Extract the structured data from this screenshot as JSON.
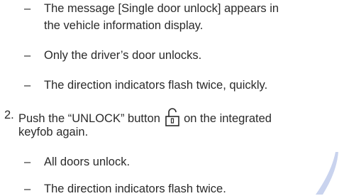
{
  "bullets_top": [
    {
      "dash": "–",
      "lines": [
        "The message [Single door unlock] appears in",
        "the vehicle information display."
      ]
    },
    {
      "dash": "–",
      "lines": [
        "Only the driver’s door unlocks."
      ]
    },
    {
      "dash": "–",
      "lines": [
        "The direction indicators flash twice, quickly."
      ]
    }
  ],
  "step2": {
    "number": "2.",
    "line1_before": "Push the “UNLOCK” button",
    "line1_after": "on the integrated",
    "line2": "keyfob again."
  },
  "bullets_bottom": [
    {
      "dash": "–",
      "lines": [
        "All doors unlock."
      ]
    },
    {
      "dash": "–",
      "lines": [
        "The direction indicators flash twice."
      ]
    }
  ],
  "icons": {
    "unlock": "unlock-padlock-icon"
  },
  "colors": {
    "text": "#2a2a2a",
    "swoosh": "#c9d3ee"
  }
}
